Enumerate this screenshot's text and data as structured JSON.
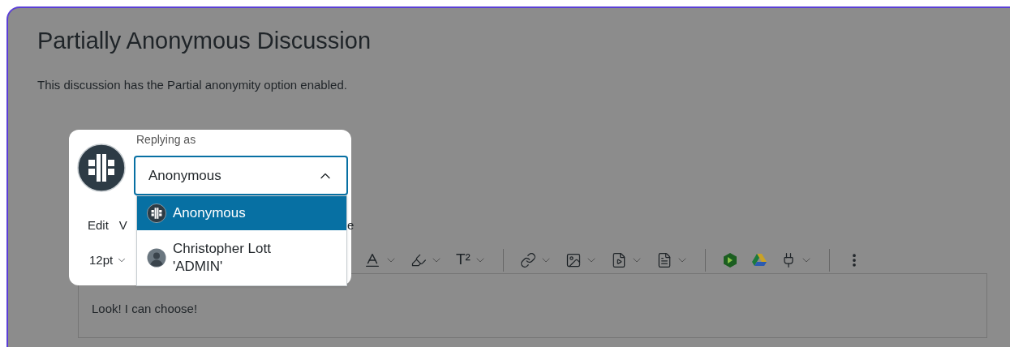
{
  "page": {
    "title": "Partially Anonymous Discussion",
    "description": "This discussion has the Partial anonymity option enabled."
  },
  "reply_as": {
    "label": "Replying as",
    "value": "Anonymous",
    "expanded": true,
    "options": [
      {
        "label": "Anonymous",
        "kind": "anonymous",
        "selected": true
      },
      {
        "label": "Christopher Lott 'ADMIN'",
        "kind": "person",
        "selected": false
      }
    ]
  },
  "menubar": [
    "Edit",
    "V",
    "e"
  ],
  "font_size": "12pt",
  "toolbar": [
    {
      "kind": "fontcolor",
      "has_menu": true
    },
    {
      "kind": "highlight",
      "has_menu": true
    },
    {
      "kind": "superscript",
      "label": "T²",
      "has_menu": true
    },
    {
      "kind": "divider"
    },
    {
      "kind": "link",
      "has_menu": true
    },
    {
      "kind": "image",
      "has_menu": true
    },
    {
      "kind": "media",
      "has_menu": true
    },
    {
      "kind": "document",
      "has_menu": true
    },
    {
      "kind": "divider"
    },
    {
      "kind": "app",
      "has_menu": false
    },
    {
      "kind": "drive",
      "has_menu": false
    },
    {
      "kind": "plug",
      "has_menu": true
    },
    {
      "kind": "divider"
    },
    {
      "kind": "more",
      "has_menu": false
    }
  ],
  "editor": {
    "text": "Look! I can choose!"
  }
}
